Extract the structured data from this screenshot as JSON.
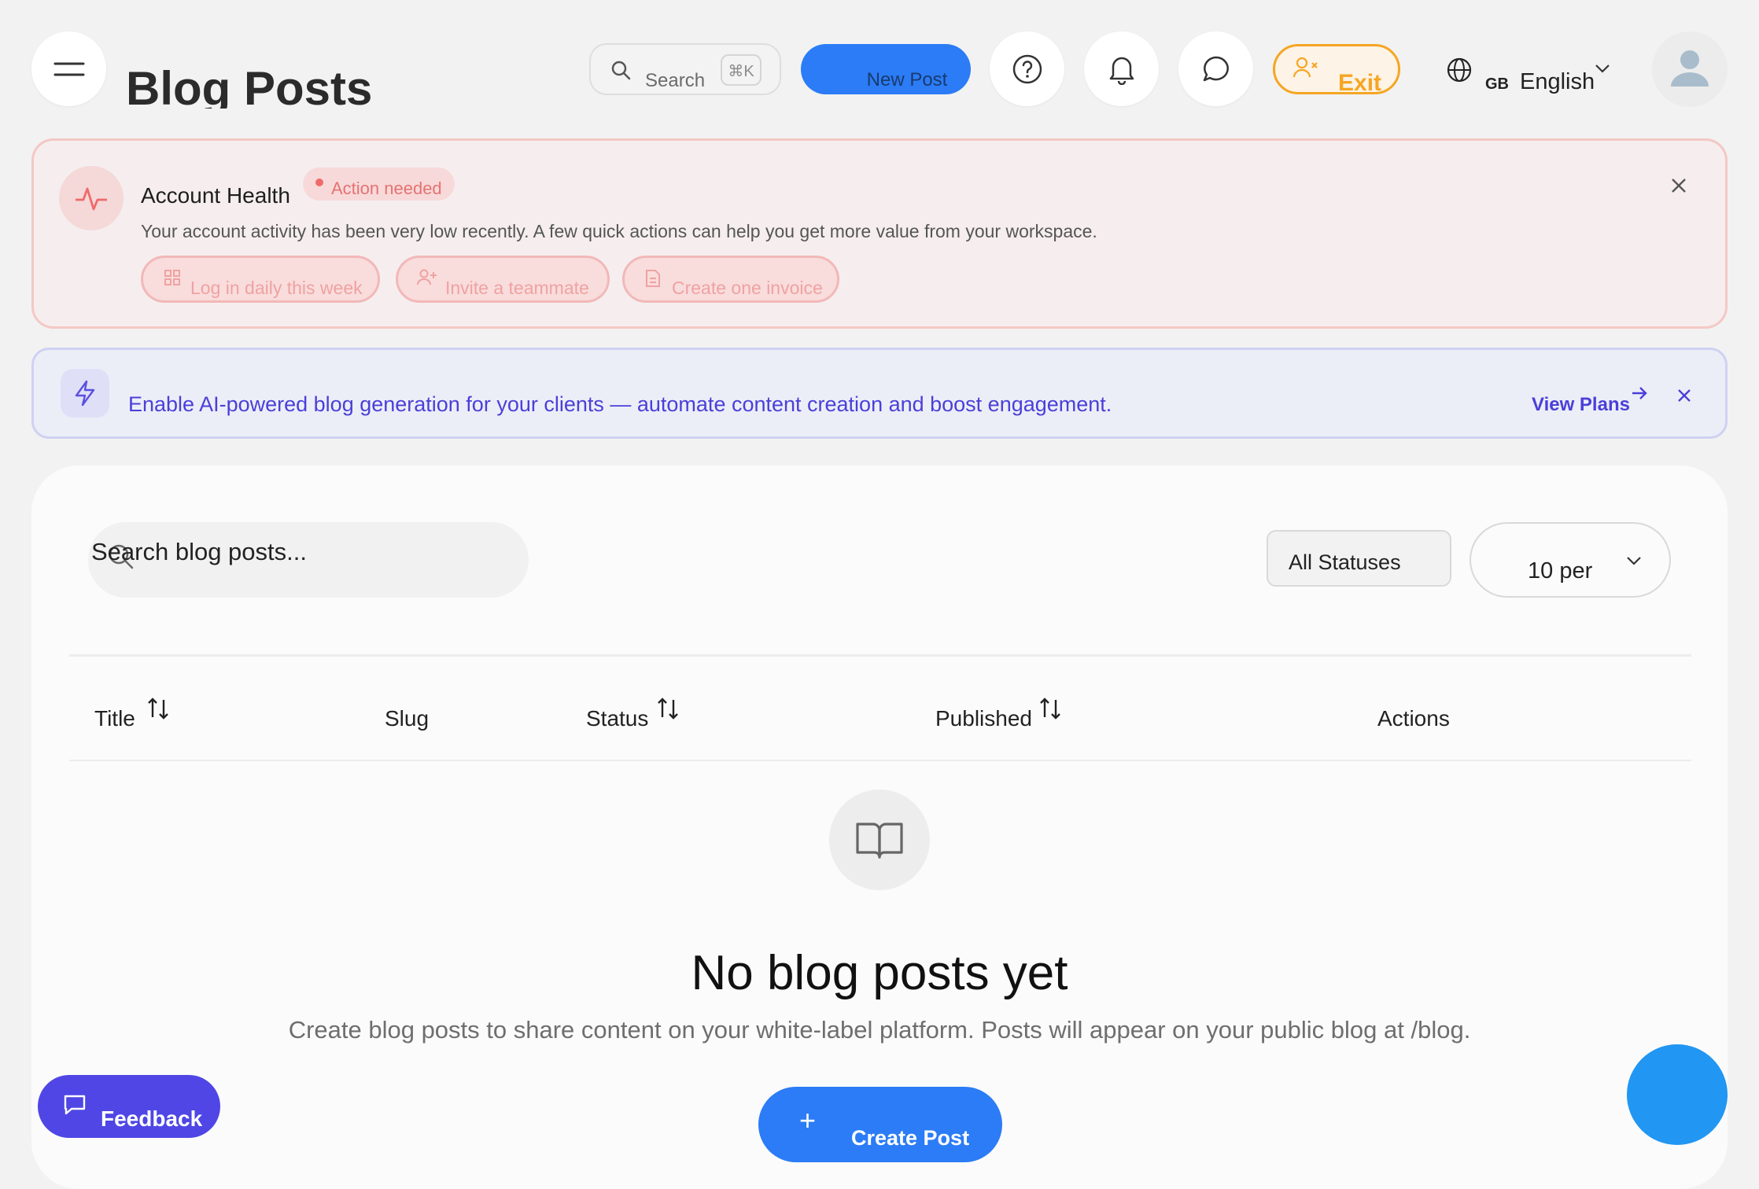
{
  "header": {
    "title": "Blog Posts",
    "search_label": "Search",
    "search_shortcut": "⌘K",
    "new_post_label": "New Post",
    "exit_label": "Exit",
    "language_code": "GB",
    "language_name": "English"
  },
  "health": {
    "title": "Account Health",
    "badge": "Action needed",
    "description": "Your account activity has been very low recently. A few quick actions can help you get more value from your workspace.",
    "actions": [
      "Log in daily this week",
      "Invite a teammate",
      "Create one invoice"
    ]
  },
  "ai_banner": {
    "text": "Enable AI-powered blog generation for your clients — automate content creation and boost engagement.",
    "link": "View Plans"
  },
  "list": {
    "search_placeholder": "Search blog posts...",
    "status_filter": "All Statuses",
    "per_page": "10 per",
    "columns": [
      "Title",
      "Slug",
      "Status",
      "Published",
      "Actions"
    ]
  },
  "empty": {
    "title": "No blog posts yet",
    "description": "Create blog posts to share content on your white-label platform. Posts will appear on your public blog at /blog.",
    "button": "Create Post"
  },
  "feedback": {
    "label": "Feedback"
  },
  "colors": {
    "accent": "#2b7cf6",
    "warning": "#f5a623",
    "danger": "#ef6a6a",
    "indigo": "#4b3fd9",
    "feedback": "#4f46e5"
  }
}
